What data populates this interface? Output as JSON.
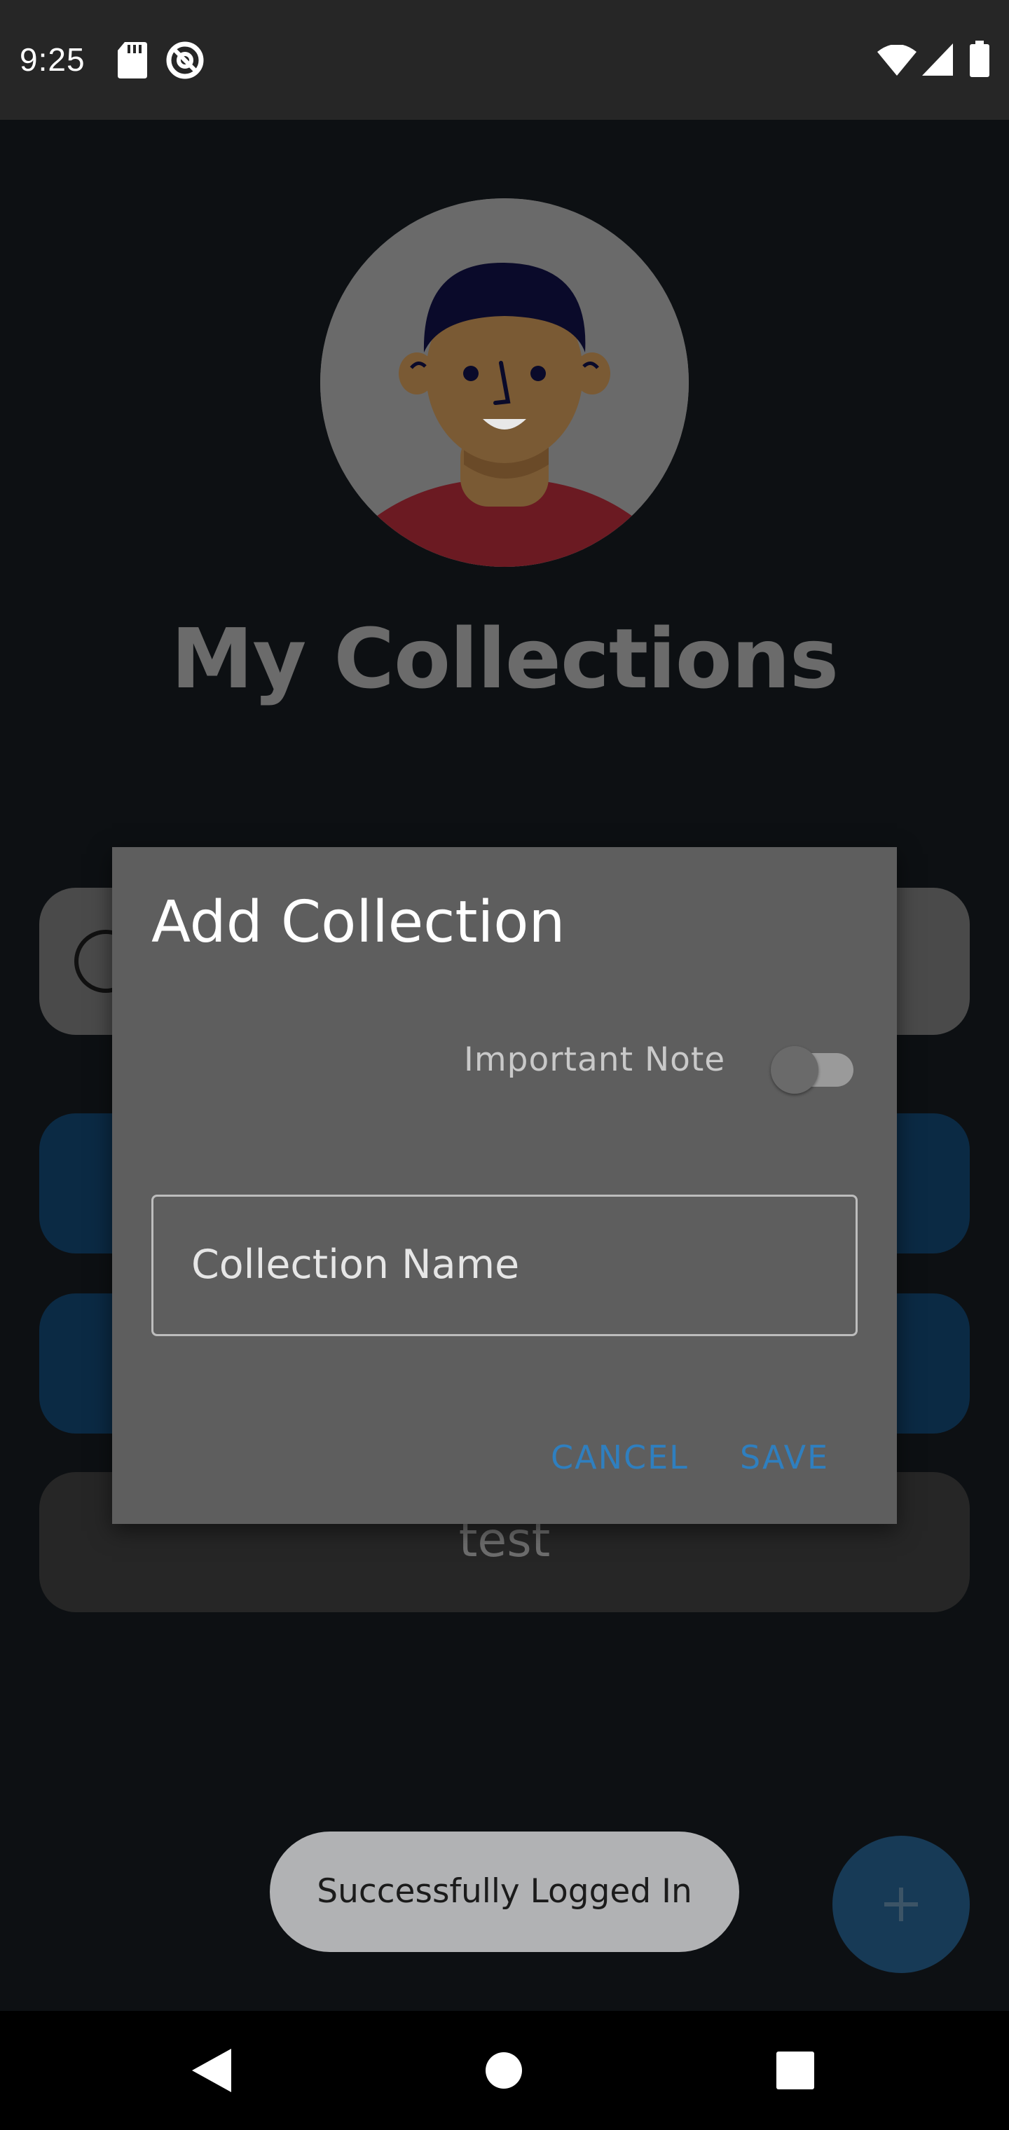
{
  "status_bar": {
    "time": "9:25"
  },
  "screen": {
    "title": "My Collections",
    "collection_items": [
      "test"
    ]
  },
  "dialog": {
    "title": "Add Collection",
    "toggle_label": "Important Note",
    "toggle_on": false,
    "field_placeholder": "Collection Name",
    "cancel_label": "CANCEL",
    "save_label": "SAVE"
  },
  "toast": {
    "message": "Successfully Logged In"
  },
  "fab": {
    "icon": "plus-icon"
  },
  "colors": {
    "accent": "#2f7fbf",
    "dialog_bg": "#5e5e5e"
  }
}
